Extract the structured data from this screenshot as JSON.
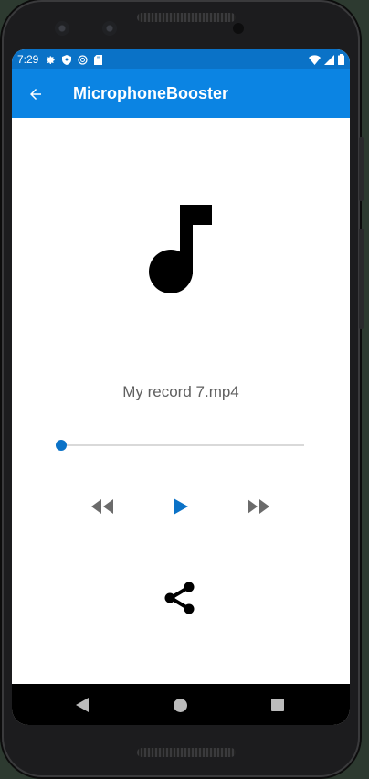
{
  "status_bar": {
    "time": "7:29",
    "icons": [
      "gear-icon",
      "shield-icon",
      "sync-icon",
      "sd-card-icon"
    ],
    "right_icons": [
      "wifi-icon",
      "signal-icon",
      "battery-icon"
    ]
  },
  "app_bar": {
    "title": "MicrophoneBooster",
    "back_icon": "arrow-left-icon"
  },
  "player": {
    "artwork_icon": "music-note-icon",
    "file_name": "My record 7.mp4",
    "progress": 0
  },
  "colors": {
    "status_bar": "#0a72c7",
    "app_bar": "#0b84e3",
    "accent": "#0b72c7",
    "control_gray": "#6b6b6b"
  },
  "nav_bar": {
    "icons": [
      "back-triangle-icon",
      "home-circle-icon",
      "recents-square-icon"
    ]
  }
}
